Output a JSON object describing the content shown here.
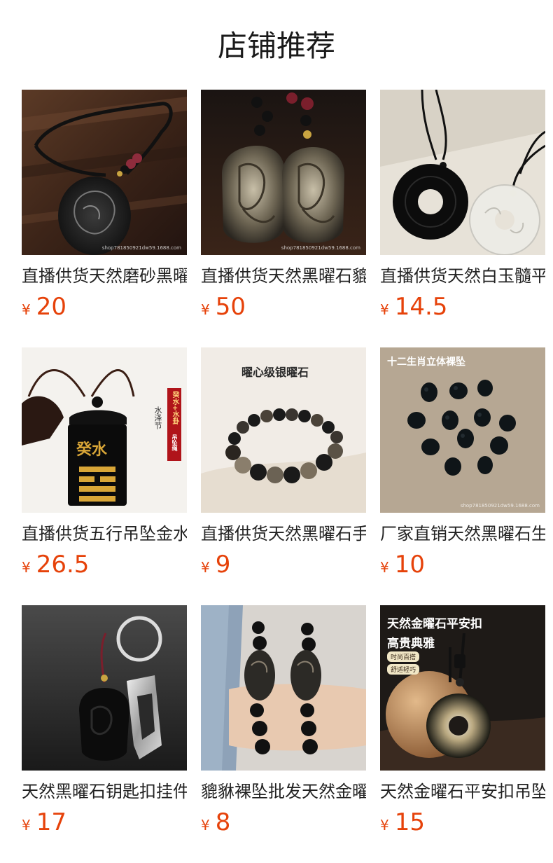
{
  "page": {
    "title": "店铺推荐"
  },
  "products": [
    {
      "title": "直播供货天然磨砂黑曜石",
      "currency": "¥",
      "price": "20",
      "image_icon": "obsidian-dragon-pendant-image",
      "watermark": "shop781850921dw59.1688.com"
    },
    {
      "title": "直播供货天然黑曜石貔貅",
      "currency": "¥",
      "price": "50",
      "image_icon": "gold-obsidian-pendants-image",
      "watermark": "shop781850921dw59.1688.com"
    },
    {
      "title": "直播供货天然白玉髓平安扣",
      "currency": "¥",
      "price": "14.5",
      "image_icon": "black-white-donut-pendants-image"
    },
    {
      "title": "直播供货五行吊坠金水",
      "currency": "¥",
      "price": "26.5",
      "image_icon": "five-elements-pendant-image",
      "overlay": {
        "left_text": "水泽节",
        "vertical_text": "癸水+水卦",
        "badge": "吊坠绳",
        "pendant_text": "癸水"
      }
    },
    {
      "title": "直播供货天然黑曜石手串",
      "currency": "¥",
      "price": "9",
      "image_icon": "obsidian-bracelet-image",
      "overlay": {
        "heading": "曜心级银曜石"
      }
    },
    {
      "title": "厂家直销天然黑曜石生肖",
      "currency": "¥",
      "price": "10",
      "image_icon": "zodiac-obsidian-carvings-image",
      "overlay": {
        "heading": "十二生肖立体裸坠"
      },
      "watermark": "shop781850921dw59.1688.com"
    },
    {
      "title": "天然黑曜石钥匙扣挂件",
      "currency": "¥",
      "price": "17",
      "image_icon": "obsidian-keychain-image"
    },
    {
      "title": "貔貅裸坠批发天然金曜石",
      "currency": "¥",
      "price": "8",
      "image_icon": "pixiu-bracelets-wrist-image"
    },
    {
      "title": "天然金曜石平安扣吊坠",
      "currency": "¥",
      "price": "15",
      "image_icon": "gold-obsidian-donut-pendant-image",
      "overlay": {
        "heading_line1": "天然金曜石平安扣",
        "heading_line2": "高贵典雅",
        "tag1": "时尚百搭",
        "tag2": "舒适轻巧"
      }
    }
  ],
  "colors": {
    "price": "#e6420a",
    "title_text": "#222222"
  }
}
